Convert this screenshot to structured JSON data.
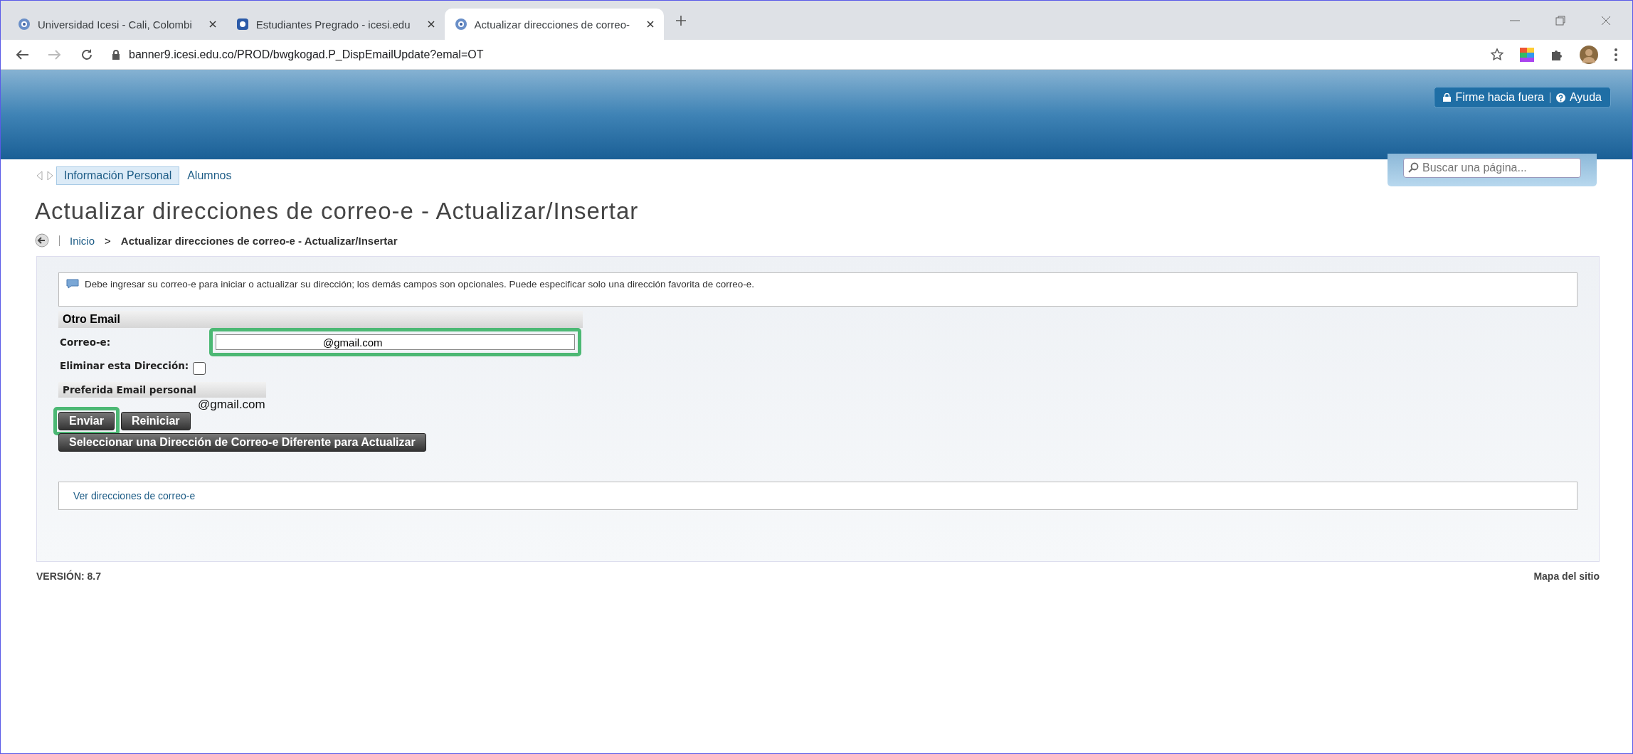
{
  "browser": {
    "tabs": [
      {
        "title": "Universidad Icesi - Cali, Colombi",
        "selected": false
      },
      {
        "title": "Estudiantes Pregrado - icesi.edu",
        "selected": false
      },
      {
        "title": "Actualizar direcciones de correo-",
        "selected": true
      }
    ],
    "url": "banner9.icesi.edu.co/PROD/bwgkogad.P_DispEmailUpdate?emal=OT"
  },
  "header": {
    "sign_out": "Firme hacia fuera",
    "help": "Ayuda"
  },
  "search": {
    "placeholder": "Buscar una página..."
  },
  "nav": [
    {
      "label": "Información Personal",
      "selected": true
    },
    {
      "label": "Alumnos",
      "selected": false
    }
  ],
  "title": "Actualizar direcciones de correo-e - Actualizar/Insertar",
  "breadcrumb": {
    "home": "Inicio",
    "separator": ">",
    "current": "Actualizar direcciones de correo-e - Actualizar/Insertar"
  },
  "notice": "Debe ingresar su correo-e para iniciar o actualizar su dirección; los demás campos son opcionales. Puede especificar solo una dirección favorita de correo-e.",
  "other_email": {
    "heading": "Otro Email",
    "email_label": "Correo-e:",
    "email_value": "@gmail.com",
    "email_highlighted": true,
    "delete_label": "Eliminar esta Dirección:",
    "delete_checked": false
  },
  "preferred": {
    "heading": "Preferida Email personal",
    "email": "@gmail.com"
  },
  "buttons": [
    {
      "label": "Enviar",
      "highlighted": true
    },
    {
      "label": "Reiniciar",
      "highlighted": false
    }
  ],
  "select_button": "Seleccionar una Dirección de Correo-e Diferente para Actualizar",
  "view_link": "Ver direcciones de correo-e",
  "footer": {
    "version": "VERSIÓN: 8.7",
    "sitemap": "Mapa del sitio"
  }
}
